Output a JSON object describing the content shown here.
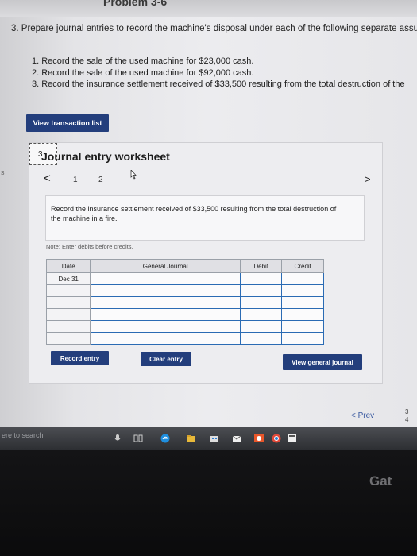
{
  "header": {
    "title": "Problem 3-6"
  },
  "question": "3. Prepare journal entries to record the machine's disposal under each of the following separate assu",
  "items": [
    "1. Record the sale of the used machine for $23,000 cash.",
    "2. Record the sale of the used machine for $92,000 cash.",
    "3. Record the insurance settlement received of $33,500 resulting from the total destruction of the"
  ],
  "buttons": {
    "view_transaction_list": "View transaction list",
    "record_entry": "Record entry",
    "clear_entry": "Clear entry",
    "view_general_journal": "View general journal"
  },
  "sidebar_fragment": "s",
  "worksheet": {
    "title": "Journal entry worksheet",
    "nav": {
      "prev": "<",
      "next": ">",
      "pages": [
        "1",
        "2",
        "3"
      ]
    },
    "description": "Record the insurance settlement received of $33,500 resulting from the total destruction of the machine in a fire.",
    "note": "Note: Enter debits before credits.",
    "table": {
      "headers": [
        "Date",
        "General Journal",
        "Debit",
        "Credit"
      ],
      "rows": [
        [
          "Dec 31",
          "",
          "",
          ""
        ],
        [
          "",
          "",
          "",
          ""
        ],
        [
          "",
          "",
          "",
          ""
        ],
        [
          "",
          "",
          "",
          ""
        ],
        [
          "",
          "",
          "",
          ""
        ],
        [
          "",
          "",
          "",
          ""
        ]
      ]
    }
  },
  "footer": {
    "prev": "Prev",
    "page_fragment_top": "3",
    "page_fragment_bottom": "4"
  },
  "taskbar": {
    "search_placeholder": "ere to search"
  },
  "laptop": {
    "brand_fragment": "Gat"
  },
  "colors": {
    "button": "#233e7c",
    "input_border": "#2a6bb4",
    "link": "#3a5aa0"
  }
}
